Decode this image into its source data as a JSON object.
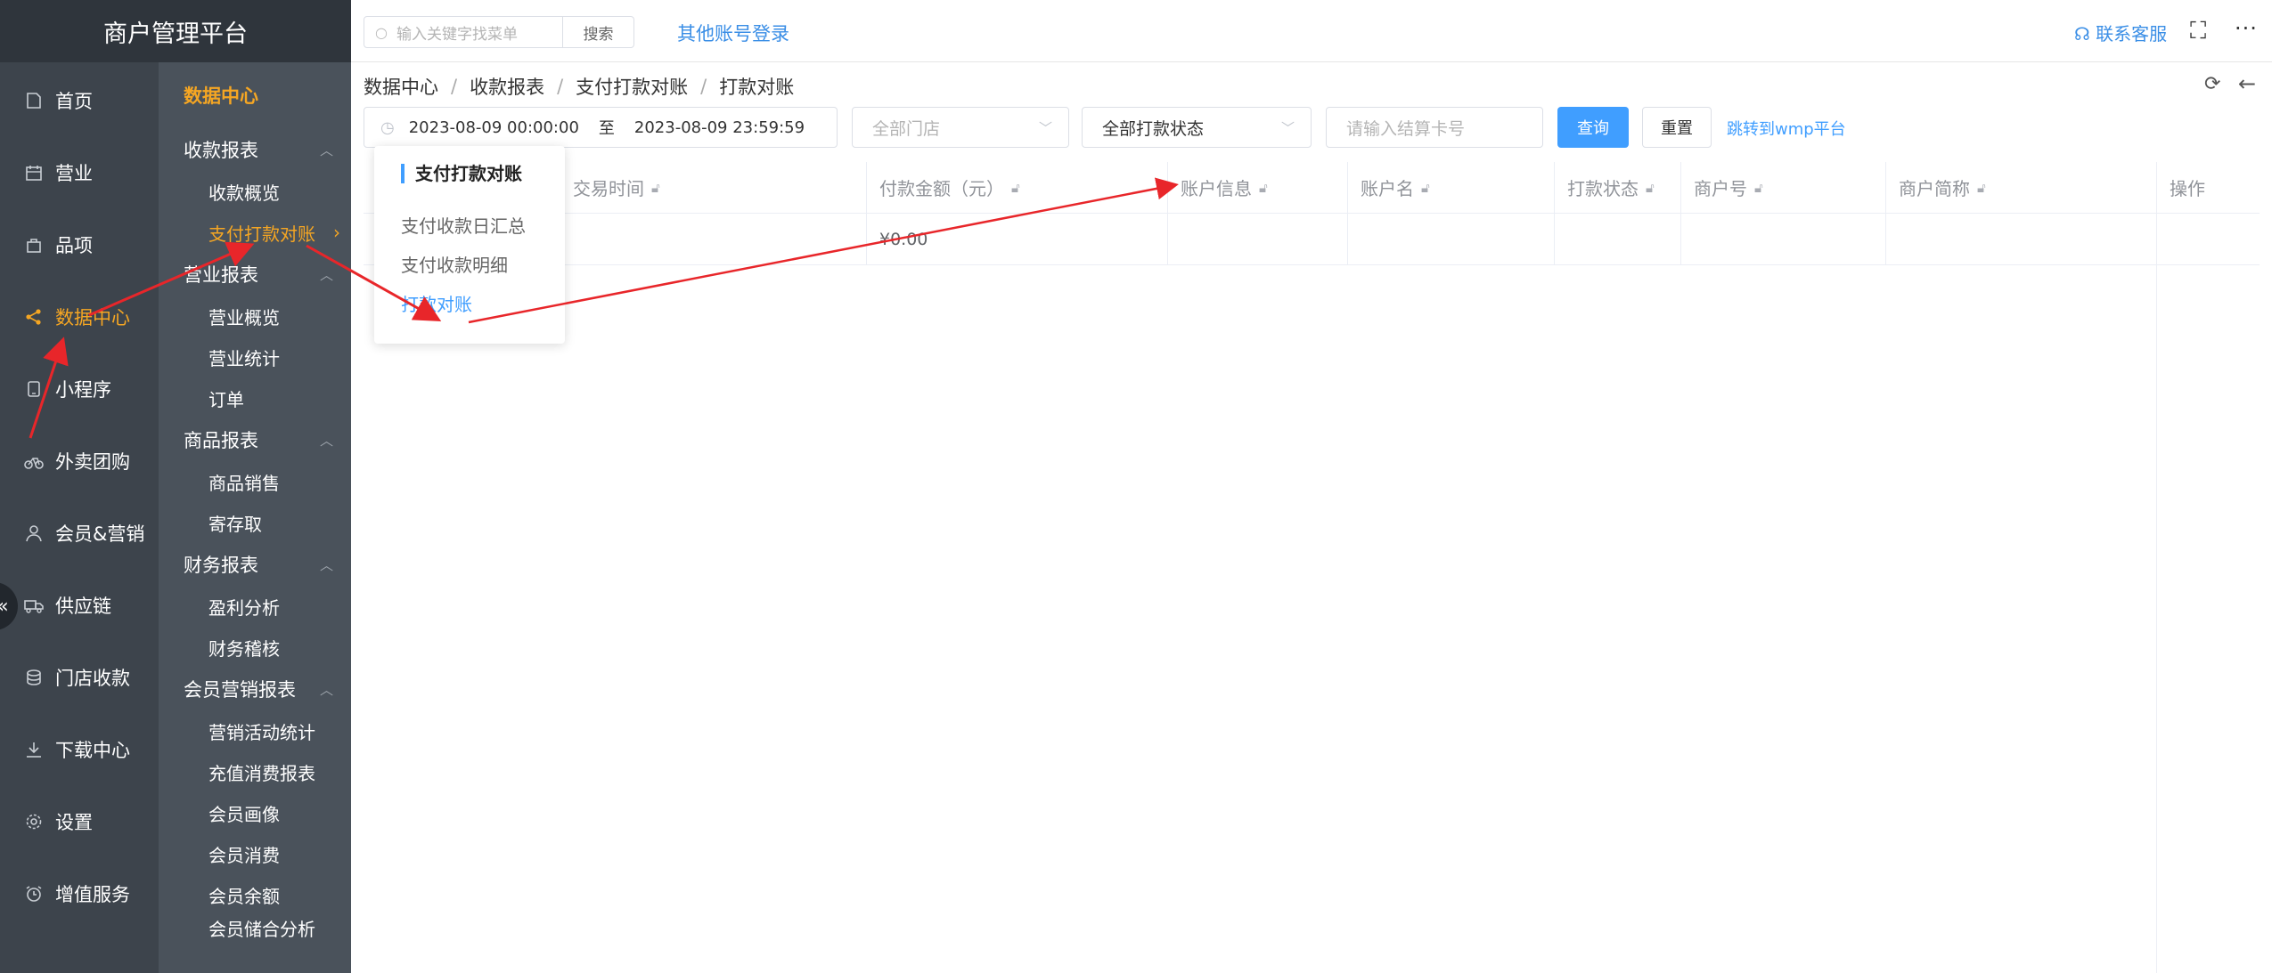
{
  "app": {
    "title": "商户管理平台"
  },
  "nav": {
    "items": [
      {
        "label": "首页",
        "icon": "home-icon"
      },
      {
        "label": "营业",
        "icon": "calendar-icon"
      },
      {
        "label": "品项",
        "icon": "bag-icon"
      },
      {
        "label": "数据中心",
        "icon": "share-icon",
        "active": true
      },
      {
        "label": "小程序",
        "icon": "tablet-icon"
      },
      {
        "label": "外卖团购",
        "icon": "bike-icon"
      },
      {
        "label": "会员&营销",
        "icon": "user-icon"
      },
      {
        "label": "供应链",
        "icon": "truck-icon"
      },
      {
        "label": "门店收款",
        "icon": "coins-icon"
      },
      {
        "label": "下载中心",
        "icon": "download-icon"
      },
      {
        "label": "设置",
        "icon": "gear-icon"
      },
      {
        "label": "增值服务",
        "icon": "alarm-icon"
      }
    ],
    "collapse": "«"
  },
  "subnav": {
    "title": "数据中心",
    "groups": [
      {
        "label": "收款报表",
        "items": [
          "收款概览",
          "支付打款对账"
        ]
      },
      {
        "label": "营业报表",
        "items": [
          "营业概览",
          "营业统计",
          "订单"
        ]
      },
      {
        "label": "商品报表",
        "items": [
          "商品销售",
          "寄存取"
        ]
      },
      {
        "label": "财务报表",
        "items": [
          "盈利分析",
          "财务稽核"
        ]
      },
      {
        "label": "会员营销报表",
        "items": [
          "营销活动统计",
          "充值消费报表",
          "会员画像",
          "会员消费",
          "会员余额",
          "会员储合分析"
        ]
      }
    ],
    "active_item": "支付打款对账"
  },
  "topbar": {
    "search_placeholder": "输入关键字找菜单",
    "search_button": "搜索",
    "other_login": "其他账号登录",
    "service": "联系客服"
  },
  "breadcrumb": [
    "数据中心",
    "收款报表",
    "支付打款对账",
    "打款对账"
  ],
  "filters": {
    "start": "2023-08-09 00:00:00",
    "to": "至",
    "end": "2023-08-09 23:59:59",
    "store_placeholder": "全部门店",
    "status_value": "全部打款状态",
    "card_placeholder": "请输入结算卡号",
    "query": "查询",
    "reset": "重置",
    "jump": "跳转到wmp平台"
  },
  "table": {
    "columns": [
      "交易时间",
      "付款金额（元）",
      "账户信息",
      "账户名",
      "打款状态",
      "商户号",
      "商户简称",
      "操作"
    ],
    "summary_amount": "¥0.00"
  },
  "popover": {
    "title": "支付打款对账",
    "items": [
      "支付收款日汇总",
      "支付收款明细",
      "打款对账"
    ],
    "active": "打款对账"
  }
}
